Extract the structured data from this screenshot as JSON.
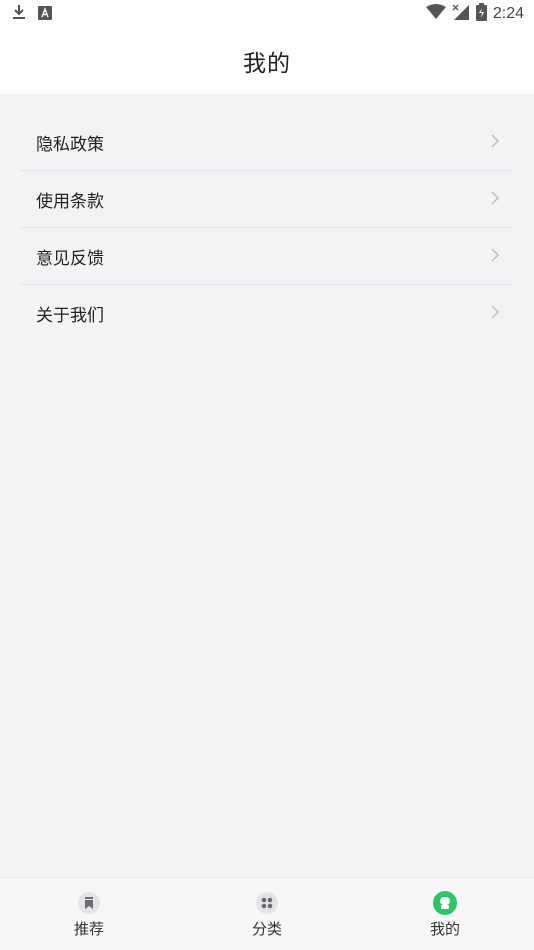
{
  "status_bar": {
    "time": "2:24",
    "left_icons": [
      "download-icon",
      "text-notification-icon"
    ],
    "right_icons": [
      "wifi-icon",
      "signal-icon",
      "battery-icon"
    ]
  },
  "header": {
    "title": "我的"
  },
  "menu": {
    "items": [
      {
        "label": "隐私政策"
      },
      {
        "label": "使用条款"
      },
      {
        "label": "意见反馈"
      },
      {
        "label": "关于我们"
      }
    ]
  },
  "tabs": [
    {
      "label": "推荐",
      "icon": "bookmark-icon",
      "active": false
    },
    {
      "label": "分类",
      "icon": "grid-icon",
      "active": false
    },
    {
      "label": "我的",
      "icon": "profile-icon",
      "active": true
    }
  ],
  "colors": {
    "accent": "#2fc46a",
    "background": "#f2f3f5",
    "text": "#222222",
    "inactive_icon_bg": "#e4e4e6"
  }
}
